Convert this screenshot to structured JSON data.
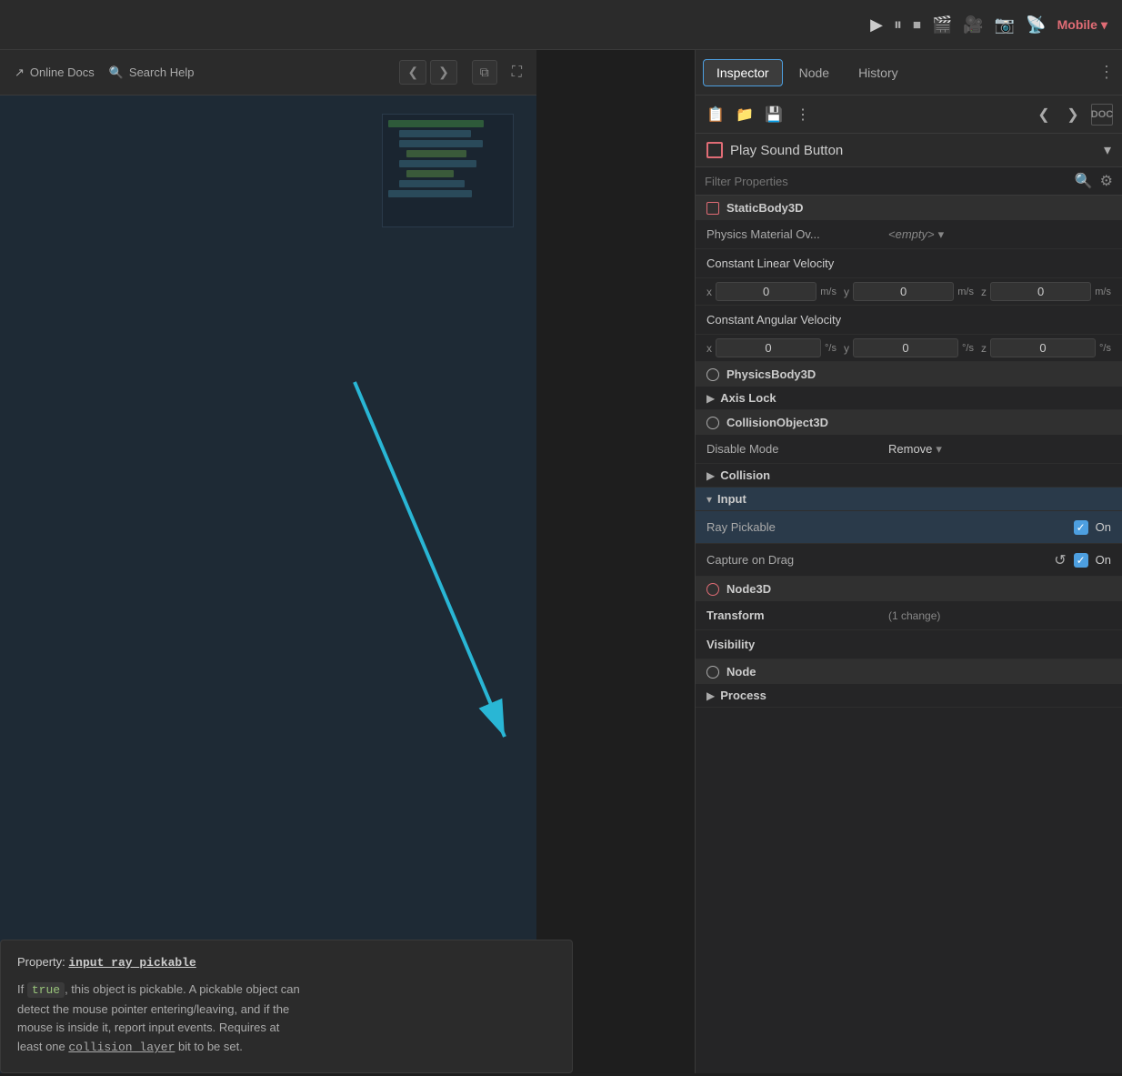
{
  "topbar": {
    "play_icon": "▶",
    "pause_icon": "⏸",
    "stop_icon": "⏹",
    "render_icon": "🎬",
    "movie_icon": "🎥",
    "camera_icon": "📷",
    "remote_icon": "📡",
    "mobile_label": "Mobile",
    "dropdown_arrow": "▾"
  },
  "inspector": {
    "tabs": [
      {
        "id": "inspector",
        "label": "Inspector",
        "active": true
      },
      {
        "id": "node",
        "label": "Node",
        "active": false
      },
      {
        "id": "history",
        "label": "History",
        "active": false
      }
    ],
    "more_icon": "⋮",
    "toolbar": {
      "new_icon": "📋",
      "open_icon": "📁",
      "save_icon": "💾",
      "menu_icon": "⋮",
      "back_icon": "❮",
      "forward_icon": "❯",
      "doc_label": "DOC"
    },
    "node_name": "Play Sound Button",
    "filter_placeholder": "Filter Properties",
    "sections": [
      {
        "type": "section-header",
        "icon": "red-square",
        "label": "StaticBody3D"
      },
      {
        "type": "prop-row",
        "label": "Physics Material Ov...",
        "value": "<empty>",
        "has_dropdown": true
      },
      {
        "type": "label-row",
        "label": "Constant Linear Velocity"
      },
      {
        "type": "velocity-row",
        "fields": [
          {
            "axis": "x",
            "value": "0",
            "unit": "m/s"
          },
          {
            "axis": "y",
            "value": "0",
            "unit": "m/s"
          },
          {
            "axis": "z",
            "value": "0",
            "unit": "m/s"
          }
        ]
      },
      {
        "type": "label-row",
        "label": "Constant Angular Velocity"
      },
      {
        "type": "velocity-row",
        "fields": [
          {
            "axis": "x",
            "value": "0",
            "unit": "°/s"
          },
          {
            "axis": "y",
            "value": "0",
            "unit": "°/s"
          },
          {
            "axis": "z",
            "value": "0",
            "unit": "°/s"
          }
        ]
      },
      {
        "type": "section-header",
        "icon": "gray-circle",
        "label": "PhysicsBody3D"
      },
      {
        "type": "collapse-row",
        "label": "Axis Lock",
        "expanded": false
      },
      {
        "type": "section-header",
        "icon": "gray-circle",
        "label": "CollisionObject3D"
      },
      {
        "type": "prop-row",
        "label": "Disable Mode",
        "value": "Remove",
        "has_dropdown": true
      },
      {
        "type": "collapse-row",
        "label": "Collision",
        "expanded": false
      },
      {
        "type": "collapse-row",
        "label": "Input",
        "expanded": true,
        "highlighted": true
      },
      {
        "type": "toggle-row",
        "label": "Ray Pickable",
        "checked": true,
        "value": "On",
        "has_reset": false,
        "highlighted": true
      },
      {
        "type": "toggle-row",
        "label": "Capture on Drag",
        "checked": true,
        "value": "On",
        "has_reset": true
      },
      {
        "type": "section-header",
        "icon": "red-circle",
        "label": "Node3D"
      },
      {
        "type": "prop-row",
        "label": "Transform",
        "value": "(1 change)"
      },
      {
        "type": "prop-row",
        "label": "Visibility",
        "value": ""
      },
      {
        "type": "section-header",
        "icon": "gray-circle",
        "label": "Node"
      },
      {
        "type": "collapse-row",
        "label": "Process",
        "expanded": false
      }
    ]
  },
  "left_panel": {
    "toolbar": {
      "online_docs_label": "Online Docs",
      "online_docs_icon": "↗",
      "search_help_label": "Search Help",
      "search_help_icon": "🔍",
      "back_label": "❮",
      "forward_label": "❯",
      "copy_icon": "⧉",
      "fullscreen_icon": "⛶"
    }
  },
  "tooltip": {
    "property_prefix": "Property: ",
    "property_name": "input_ray_pickable",
    "description_line1": "If ",
    "true_code": "true",
    "description_line2": ", this object is pickable. A pickable object can",
    "description_line3": "detect the mouse pointer entering/leaving, and if the",
    "description_line4": "mouse is inside it, report input events. Requires at",
    "description_line5": "least one ",
    "collision_code": "collision_layer",
    "description_line6": " bit to be set."
  },
  "arrow": {
    "color": "#29b6d5"
  }
}
